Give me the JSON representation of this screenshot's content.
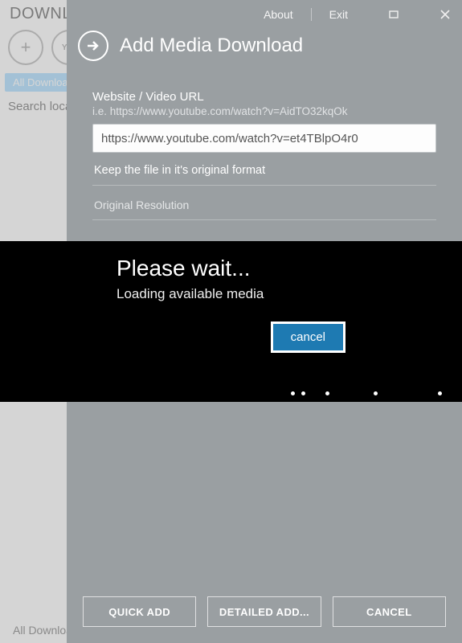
{
  "main": {
    "title": "DOWNLOAD",
    "tabs": {
      "all": "All Downloads"
    },
    "search_label": "Search local",
    "status": "All Downloads"
  },
  "panel": {
    "header": {
      "about": "About",
      "exit": "Exit"
    },
    "title": "Add Media Download",
    "form": {
      "url_label": "Website / Video URL",
      "url_hint": "i.e. https://www.youtube.com/watch?v=AidTO32kqOk",
      "url_value": "https://www.youtube.com/watch?v=et4TBlpO4r0",
      "format_option": "Keep the file in it's original format",
      "resolution_option": "Original Resolution"
    },
    "actions": {
      "quick_add": "QUICK ADD",
      "detailed_add": "DETAILED ADD...",
      "cancel": "CANCEL"
    }
  },
  "loading": {
    "title": "Please wait...",
    "message": "Loading available media",
    "cancel": "cancel"
  }
}
